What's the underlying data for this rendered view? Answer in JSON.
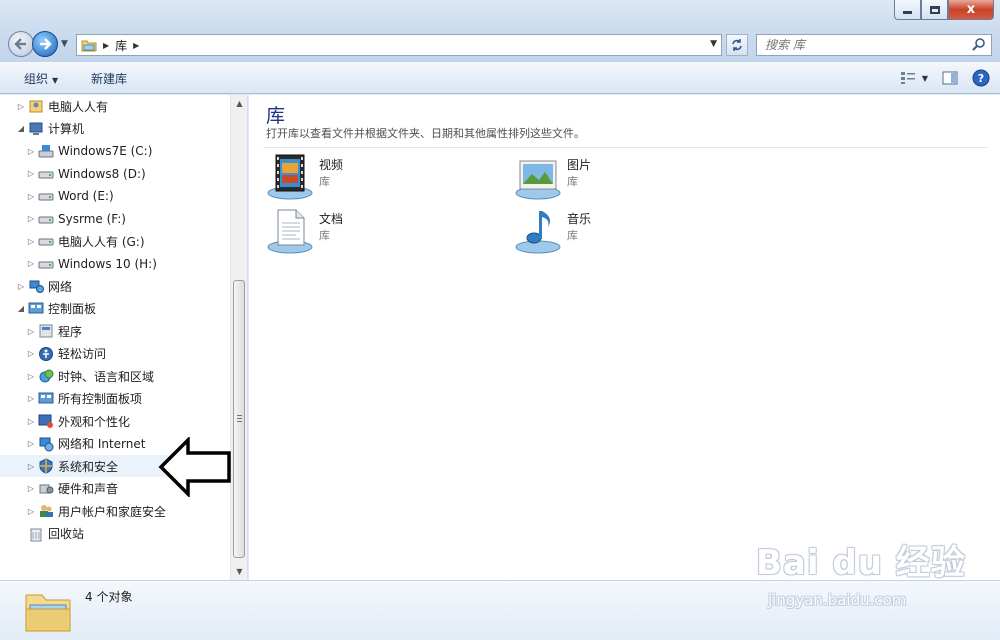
{
  "window": {
    "minimize_icon": "minimize-icon",
    "maximize_icon": "maximize-icon",
    "close_label": "x"
  },
  "address": {
    "crumb": "库",
    "search_placeholder": "搜索 库"
  },
  "toolbar": {
    "organize_label": "组织",
    "new_library_label": "新建库"
  },
  "tree": [
    {
      "label": "电脑人人有",
      "indent": 1,
      "expander": "collapsed",
      "icon": "user-folder-icon"
    },
    {
      "label": "计算机",
      "indent": 1,
      "expander": "expanded",
      "icon": "computer-icon"
    },
    {
      "label": "Windows7E (C:)",
      "indent": 2,
      "expander": "collapsed",
      "icon": "system-drive-icon"
    },
    {
      "label": "Windows8 (D:)",
      "indent": 2,
      "expander": "collapsed",
      "icon": "drive-icon"
    },
    {
      "label": "Word (E:)",
      "indent": 2,
      "expander": "collapsed",
      "icon": "drive-icon"
    },
    {
      "label": "Sysrme (F:)",
      "indent": 2,
      "expander": "collapsed",
      "icon": "drive-icon"
    },
    {
      "label": "电脑人人有 (G:)",
      "indent": 2,
      "expander": "collapsed",
      "icon": "drive-icon"
    },
    {
      "label": "Windows 10 (H:)",
      "indent": 2,
      "expander": "collapsed",
      "icon": "drive-icon"
    },
    {
      "label": "网络",
      "indent": 1,
      "expander": "collapsed",
      "icon": "network-icon"
    },
    {
      "label": "控制面板",
      "indent": 1,
      "expander": "expanded",
      "icon": "control-panel-icon"
    },
    {
      "label": "程序",
      "indent": 2,
      "expander": "collapsed",
      "icon": "programs-icon"
    },
    {
      "label": "轻松访问",
      "indent": 2,
      "expander": "collapsed",
      "icon": "ease-of-access-icon"
    },
    {
      "label": "时钟、语言和区域",
      "indent": 2,
      "expander": "collapsed",
      "icon": "clock-region-icon"
    },
    {
      "label": "所有控制面板项",
      "indent": 2,
      "expander": "collapsed",
      "icon": "control-panel-icon"
    },
    {
      "label": "外观和个性化",
      "indent": 2,
      "expander": "collapsed",
      "icon": "appearance-icon"
    },
    {
      "label": "网络和 Internet",
      "indent": 2,
      "expander": "collapsed",
      "icon": "network-internet-icon"
    },
    {
      "label": "系统和安全",
      "indent": 2,
      "expander": "collapsed",
      "icon": "system-security-icon",
      "highlighted": true
    },
    {
      "label": "硬件和声音",
      "indent": 2,
      "expander": "collapsed",
      "icon": "hardware-sound-icon"
    },
    {
      "label": "用户帐户和家庭安全",
      "indent": 2,
      "expander": "collapsed",
      "icon": "user-accounts-icon"
    },
    {
      "label": "回收站",
      "indent": 1,
      "expander": "none",
      "icon": "recycle-bin-icon"
    }
  ],
  "content": {
    "title": "库",
    "description": "打开库以查看文件并根据文件夹、日期和其他属性排列这些文件。",
    "libraries": [
      {
        "name": "视频",
        "type": "库",
        "icon": "videos-library-icon"
      },
      {
        "name": "图片",
        "type": "库",
        "icon": "pictures-library-icon"
      },
      {
        "name": "文档",
        "type": "库",
        "icon": "documents-library-icon"
      },
      {
        "name": "音乐",
        "type": "库",
        "icon": "music-library-icon"
      }
    ]
  },
  "status": {
    "text": "4 个对象"
  },
  "watermark": {
    "main": "Bai du 经验",
    "sub": "jingyan.baidu.com"
  },
  "colors": {
    "title_blue": "#1e3287",
    "toolbar_text": "#1e395b",
    "close_red": "#c7432a"
  }
}
